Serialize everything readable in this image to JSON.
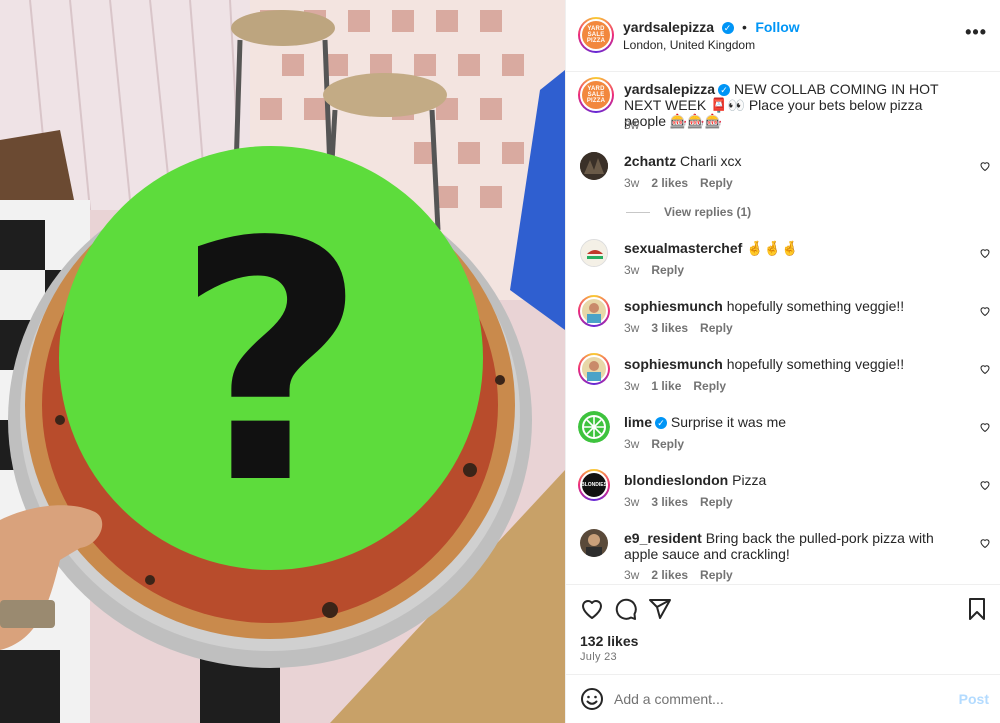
{
  "post": {
    "username": "yardsalepizza",
    "follow_label": "Follow",
    "dot": "•",
    "location": "London, United Kingdom",
    "more_label": "•••",
    "logo_text": "YARD SALE PIZZA",
    "verified_mark": "✓"
  },
  "caption": {
    "username": "yardsalepizza",
    "text": "NEW COLLAB COMING IN HOT NEXT WEEK 📮👀 Place your bets below pizza people 🎰🎰🎰",
    "time": "3w"
  },
  "comments": [
    {
      "username": "2chantz",
      "text": "Charli xcx",
      "time": "3w",
      "likes": "2 likes",
      "reply": "Reply",
      "verified": false,
      "avatar_color": "#3a3028"
    },
    {
      "username": "sexualmasterchef",
      "text": "🤞🤞🤞",
      "time": "3w",
      "likes": "",
      "reply": "Reply",
      "verified": false,
      "avatar_color": "#f4f0e6"
    },
    {
      "username": "sophiesmunch",
      "text": "hopefully something veggie!!",
      "time": "3w",
      "likes": "3 likes",
      "reply": "Reply",
      "verified": false,
      "avatar_color": "#e8d7a8"
    },
    {
      "username": "sophiesmunch",
      "text": "hopefully something veggie!!",
      "time": "3w",
      "likes": "1 like",
      "reply": "Reply",
      "verified": false,
      "avatar_color": "#e8d7a8"
    },
    {
      "username": "lime",
      "text": "Surprise it was me",
      "time": "3w",
      "likes": "",
      "reply": "Reply",
      "verified": true,
      "avatar_color": "#3ec33e"
    },
    {
      "username": "blondieslondon",
      "text": "Pizza",
      "time": "3w",
      "likes": "3 likes",
      "reply": "Reply",
      "verified": false,
      "avatar_color": "#111111"
    },
    {
      "username": "e9_resident",
      "text": "Bring back the pulled-pork pizza with apple sauce and crackling!",
      "time": "3w",
      "likes": "2 likes",
      "reply": "Reply",
      "verified": false,
      "avatar_color": "#5a4a3a"
    }
  ],
  "view_replies": "View replies (1)",
  "avatar_text": {
    "blondies": "BLONDIES"
  },
  "actions": {
    "likes_count": "132 likes",
    "date": "July 23"
  },
  "add_comment": {
    "placeholder": "Add a comment...",
    "post_label": "Post"
  },
  "colors": {
    "accent": "#0095f6",
    "mystery_circle": "#5ddc3c",
    "post_disabled": "#b3dbff"
  },
  "photo": {
    "overlay_symbol": "?"
  }
}
